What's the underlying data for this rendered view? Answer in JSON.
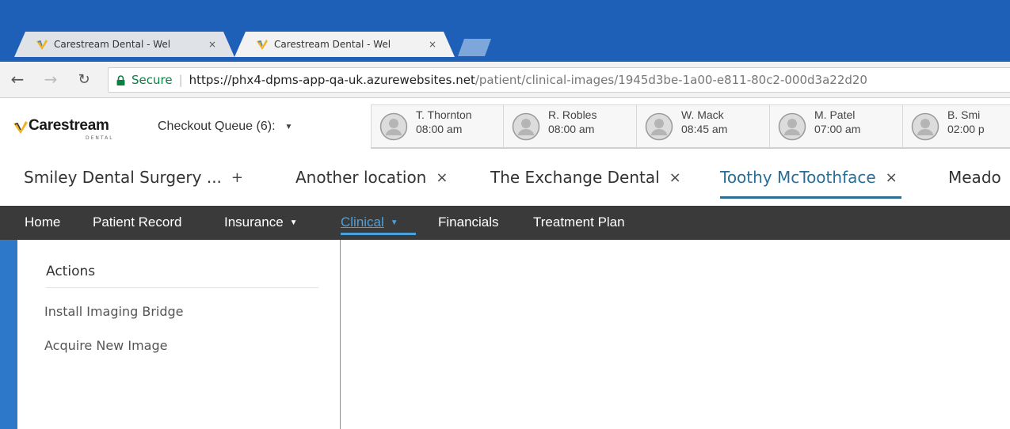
{
  "browser": {
    "tabs": [
      {
        "title": "Carestream Dental - Wel",
        "close": "×",
        "favicon": "carestream-favicon-icon"
      },
      {
        "title": "Carestream Dental - Wel",
        "close": "×",
        "favicon": "carestream-favicon-icon"
      }
    ],
    "active_tab": 1,
    "address": {
      "secure_label": "Secure",
      "separator": "|",
      "url_host": "https://phx4-dpms-app-qa-uk.azurewebsites.net",
      "url_path": "/patient/clinical-images/1945d3be-1a00-e811-80c2-000d3a22d20"
    },
    "colors": {
      "titlebar": "#1e5fb8",
      "secure": "#0b8043"
    }
  },
  "header": {
    "logo_text": "Carestream",
    "logo_sub": "DENTAL",
    "queue_label": "Checkout Queue (6):",
    "queue_caret": "▼",
    "appointments": [
      {
        "name": "T. Thornton",
        "time": "08:00 am"
      },
      {
        "name": "R. Robles",
        "time": "08:00 am"
      },
      {
        "name": "W. Mack",
        "time": "08:45 am"
      },
      {
        "name": "M. Patel",
        "time": "07:00 am"
      },
      {
        "name": "B. Smi",
        "time": "02:00 p"
      }
    ]
  },
  "locations": {
    "items": [
      {
        "label": "Smiley Dental Surgery ...",
        "action": "+"
      },
      {
        "label": "Another location",
        "action": "×"
      },
      {
        "label": "The Exchange Dental",
        "action": "×"
      },
      {
        "label": "Toothy McToothface",
        "action": "×"
      },
      {
        "label": "Meado",
        "action": ""
      }
    ],
    "active_index": 3,
    "accent": "#2a6d96"
  },
  "nav": {
    "items": [
      {
        "label": "Home",
        "dropdown": ""
      },
      {
        "label": "Patient Record",
        "dropdown": ""
      },
      {
        "label": "Insurance",
        "dropdown": "▼"
      },
      {
        "label": "Clinical",
        "dropdown": "▼"
      },
      {
        "label": "Financials",
        "dropdown": ""
      },
      {
        "label": "Treatment Plan",
        "dropdown": ""
      }
    ],
    "active_index": 3,
    "accent": "#4aa0dd"
  },
  "sidebar": {
    "title": "Actions",
    "links": [
      {
        "label": "Install Imaging Bridge"
      },
      {
        "label": "Acquire New Image"
      }
    ]
  }
}
